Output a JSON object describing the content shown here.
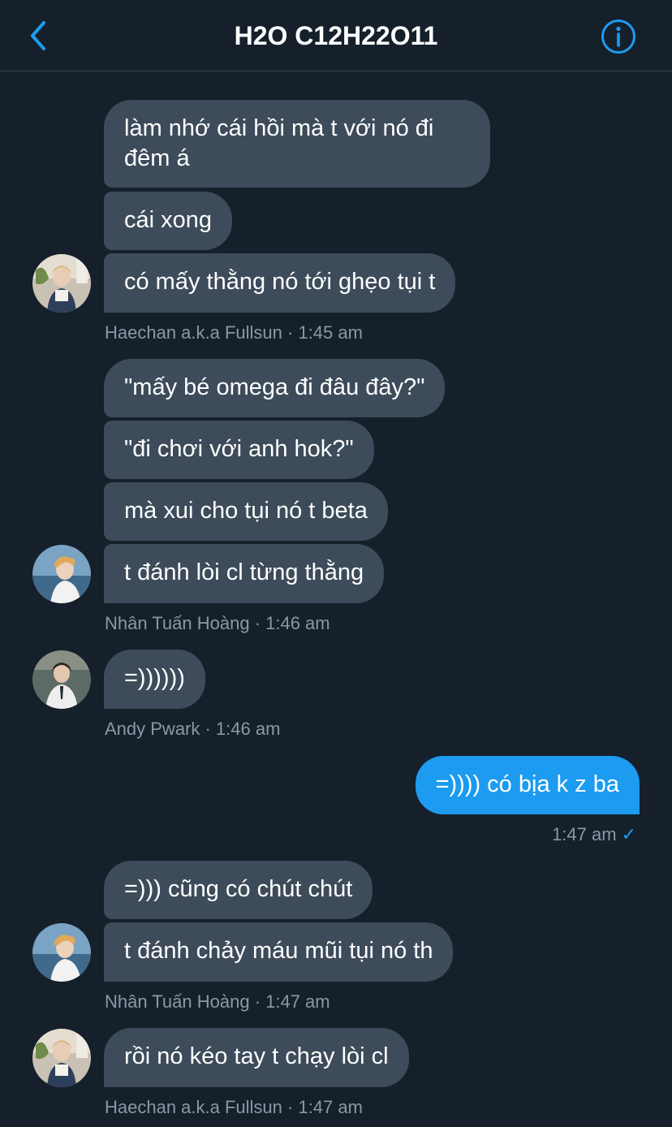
{
  "header": {
    "title": "H2O C12H22O11",
    "back_icon": "chevron-left-icon",
    "info_icon": "info-circle-icon",
    "accent": "#1d9bf0"
  },
  "messages": [
    {
      "text": "làm nhớ cái hồi mà t với nó đi đêm á"
    },
    {
      "text": "cái xong"
    },
    {
      "text": "có mấy thằng nó tới ghẹo tụi t"
    },
    {
      "text": "\"mấy bé omega đi đâu đây?\""
    },
    {
      "text": "\"đi chơi với anh hok?\""
    },
    {
      "text": "mà xui cho tụi nó t beta"
    },
    {
      "text": "t đánh lòi cl từng thằng"
    },
    {
      "text": "=))))))"
    },
    {
      "text": "=)))) có bịa k z ba"
    },
    {
      "text": "=))) cũng có chút chút"
    },
    {
      "text": "t đánh chảy máu mũi tụi nó th"
    },
    {
      "text": "rồi nó kéo tay t chạy lòi cl"
    }
  ],
  "meta": [
    {
      "text": "Haechan a.k.a Fullsun · 1:45 am"
    },
    {
      "text": "Nhân Tuấn Hoàng · 1:46 am"
    },
    {
      "text": "Andy Pwark · 1:46 am"
    },
    {
      "text": "1:47 am",
      "status": "✓"
    },
    {
      "text": "Nhân Tuấn Hoàng · 1:47 am"
    },
    {
      "text": "Haechan a.k.a Fullsun · 1:47 am"
    }
  ]
}
